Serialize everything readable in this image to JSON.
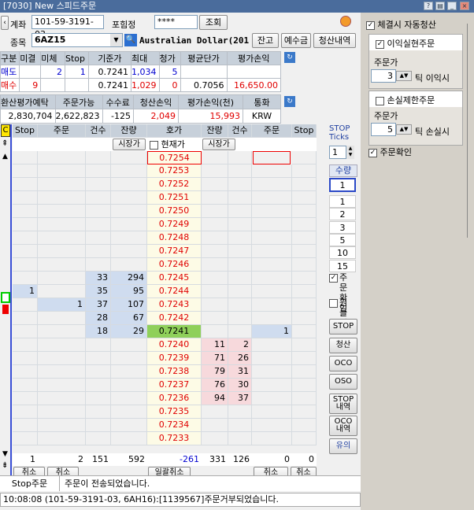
{
  "window": {
    "title": "[7030] New 스피드주문"
  },
  "account": {
    "label": "계좌",
    "number": "101-59-3191-03",
    "holder_label": "포힘정",
    "password": "****",
    "lookup_label": "조회"
  },
  "symbol": {
    "label": "종목",
    "code": "6AZ15",
    "name": "Australian Dollar(201",
    "btn_balance": "잔고",
    "btn_deposit": "예수금",
    "btn_settle": "청산내역"
  },
  "position": {
    "headers": [
      "구분",
      "미결",
      "미체",
      "Stop",
      "기준가",
      "최대",
      "청가",
      "평균단가",
      "평가손익"
    ],
    "rows": [
      {
        "side": "매도",
        "open": "",
        "unfilled": "2",
        "stop": "1",
        "base": "0.7241",
        "max": "1,034",
        "settle": "5",
        "avg": "",
        "pnl": ""
      },
      {
        "side": "매수",
        "open": "9",
        "unfilled": "",
        "stop": "",
        "base": "0.7241",
        "max": "1,029",
        "settle": "0",
        "avg": "0.7056",
        "pnl": "16,650.00"
      }
    ]
  },
  "summary": {
    "headers": [
      "환산평가예탁",
      "주문가능",
      "수수료",
      "청산손익",
      "평가손익(천)",
      "통화"
    ],
    "values": [
      "2,830,704",
      "2,622,823",
      "-125",
      "2,049",
      "15,993",
      "KRW"
    ]
  },
  "ladder": {
    "headers": [
      "Stop",
      "주문",
      "건수",
      "잔량",
      "호가",
      "잔량",
      "건수",
      "주문",
      "Stop"
    ],
    "subheaders": {
      "market_sell": "시장가",
      "current": "현재가",
      "market_buy": "시장가"
    },
    "prices": [
      "0.7254",
      "0.7253",
      "0.7252",
      "0.7251",
      "0.7250",
      "0.7249",
      "0.7248",
      "0.7247",
      "0.7246",
      "0.7245",
      "0.7244",
      "0.7243",
      "0.7242",
      "0.7241",
      "0.7240",
      "0.7239",
      "0.7238",
      "0.7237",
      "0.7236",
      "0.7235",
      "0.7234",
      "0.7233"
    ],
    "ask_count": [
      "",
      "",
      "",
      "",
      "",
      "",
      "",
      "",
      "",
      "33",
      "35",
      "37",
      "28",
      "18",
      "",
      "",
      "",
      "",
      "",
      "",
      "",
      ""
    ],
    "ask_qty": [
      "",
      "",
      "",
      "",
      "",
      "",
      "",
      "",
      "",
      "294",
      "95",
      "107",
      "67",
      "29",
      "",
      "",
      "",
      "",
      "",
      "",
      "",
      ""
    ],
    "bid_qty": [
      "",
      "",
      "",
      "",
      "",
      "",
      "",
      "",
      "",
      "",
      "",
      "",
      "",
      "",
      "11",
      "71",
      "79",
      "76",
      "94",
      "",
      "",
      ""
    ],
    "bid_count": [
      "",
      "",
      "",
      "",
      "",
      "",
      "",
      "",
      "",
      "",
      "",
      "",
      "",
      "",
      "2",
      "26",
      "31",
      "30",
      "37",
      "",
      "",
      ""
    ],
    "sell_stop": {
      "row": 10,
      "value": "1"
    },
    "sell_order": {
      "row": 11,
      "value": "1"
    },
    "buy_order": {
      "row": 13,
      "value": "1"
    },
    "current_row": 13,
    "totals": [
      "1",
      "2",
      "151",
      "592",
      "-261",
      "331",
      "126",
      "0",
      "0"
    ],
    "cancel_labels": [
      "취소",
      "취소",
      "일괄취소",
      "취소",
      "취소"
    ]
  },
  "side_controls": {
    "stop_ticks_label": "STOP Ticks",
    "stop_ticks_value": "1",
    "qty_label": "수량",
    "qty_value": "1",
    "qty_options": [
      "1",
      "2",
      "3",
      "5",
      "10",
      "15"
    ],
    "order_confirm": "주문 확인",
    "one_click": "원 클릭",
    "buttons": [
      "STOP",
      "청산",
      "OCO",
      "OSO",
      "STOP 내역",
      "OCO 내역",
      "유의"
    ]
  },
  "status": {
    "label": "Stop주문",
    "message": "주문이 전송되었습니다.",
    "log": "10:08:08 (101-59-3191-03, 6AH16):[1139567]주문거부되었습니다."
  },
  "right_panel": {
    "auto_settle": "체결시 자동청산",
    "profit_order": "이익실현주문",
    "profit_price_label": "주문가",
    "profit_ticks": "3",
    "profit_suffix": "틱 이익시",
    "loss_order": "손실제한주문",
    "loss_price_label": "주문가",
    "loss_ticks": "5",
    "loss_suffix": "틱 손실시",
    "order_confirm": "주문확인"
  }
}
